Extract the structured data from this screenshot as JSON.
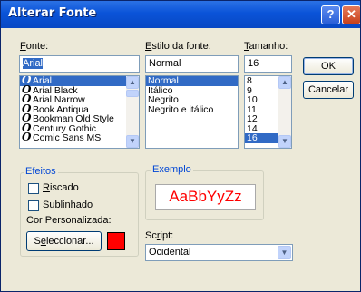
{
  "dialog": {
    "title": "Alterar Fonte",
    "help_glyph": "?",
    "close_glyph": "✕"
  },
  "font": {
    "label": "Fonte:",
    "value": "Arial",
    "items": [
      {
        "name": "Arial",
        "selected": true
      },
      {
        "name": "Arial Black",
        "selected": false
      },
      {
        "name": "Arial Narrow",
        "selected": false
      },
      {
        "name": "Book Antiqua",
        "selected": false
      },
      {
        "name": "Bookman Old Style",
        "selected": false
      },
      {
        "name": "Century Gothic",
        "selected": false
      },
      {
        "name": "Comic Sans MS",
        "selected": false
      }
    ]
  },
  "style": {
    "label": "Estilo da fonte:",
    "value": "Normal",
    "items": [
      "Normal",
      "Itálico",
      "Negrito",
      "Negrito e itálico"
    ],
    "selected_index": 0
  },
  "size": {
    "label": "Tamanho:",
    "value": "16",
    "items": [
      "8",
      "9",
      "10",
      "11",
      "12",
      "14",
      "16"
    ],
    "selected_index": 6
  },
  "buttons": {
    "ok": "OK",
    "cancel": "Cancelar",
    "select_color": "Seleccionar..."
  },
  "effects": {
    "title": "Efeitos",
    "strikeout_label": "Riscado",
    "strikeout_checked": false,
    "underline_label": "Sublinhado",
    "underline_checked": false,
    "custom_color_label": "Cor Personalizada:",
    "color": "#ff0000"
  },
  "sample": {
    "title": "Exemplo",
    "text": "AaBbYyZz",
    "text_color": "#ff0000"
  },
  "script": {
    "label": "Script:",
    "value": "Ocidental"
  },
  "colors": {
    "selection": "#316ac5",
    "group_title": "#0046d5"
  },
  "icons": {
    "font_item": "truetype-font-icon",
    "scroll_up": "scroll-up-arrow-icon",
    "scroll_down": "scroll-down-arrow-icon",
    "dropdown": "dropdown-arrow-icon"
  }
}
